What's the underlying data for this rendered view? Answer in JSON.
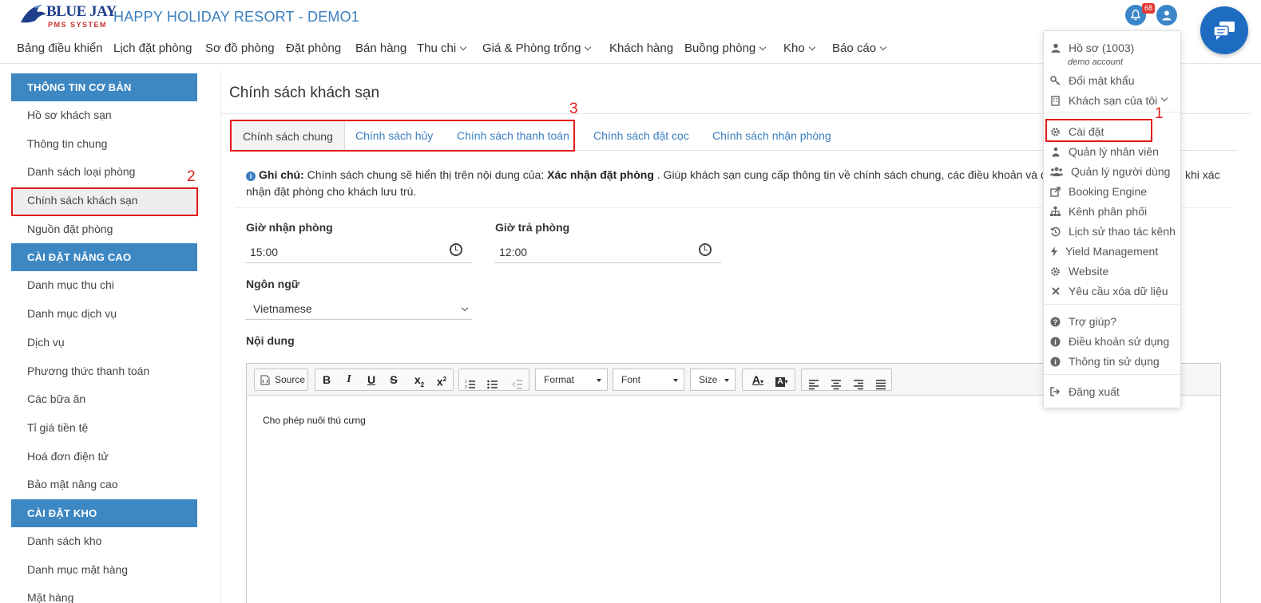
{
  "brand": {
    "logo_main": "BLUE JAY",
    "logo_sub": "PMS SYSTEM",
    "app_title": "HAPPY HOLIDAY RESORT - DEMO1",
    "notification_count": "68"
  },
  "nav": [
    {
      "label": "Bảng điều khiển"
    },
    {
      "label": "Lịch đặt phòng"
    },
    {
      "label": "Sơ đồ phòng"
    },
    {
      "label": "Đặt phòng"
    },
    {
      "label": "Bán hàng"
    },
    {
      "label": "Thu chi"
    },
    {
      "label": "Giá & Phòng trống"
    },
    {
      "label": "Khách hàng"
    },
    {
      "label": "Buồng phòng"
    },
    {
      "label": "Kho"
    },
    {
      "label": "Báo cáo"
    }
  ],
  "sidebar": {
    "section_basic": "THÔNG TIN CƠ BẢN",
    "basic_items": [
      "Hồ sơ khách sạn",
      "Thông tin chung",
      "Danh sách loại phòng",
      "Chính sách khách sạn",
      "Nguồn đặt phòng"
    ],
    "section_advanced": "CÀI ĐẶT NÂNG CAO",
    "advanced_items": [
      "Danh mục thu chi",
      "Danh mục dịch vụ",
      "Dịch vụ",
      "Phương thức thanh toán",
      "Các bữa ăn",
      "Tỉ giá tiền tệ",
      "Hoá đơn điện tử",
      "Bảo mật nâng cao"
    ],
    "section_stock": "CÀI ĐẶT KHO",
    "stock_items": [
      "Danh sách kho",
      "Danh mục mặt hàng",
      "Mặt hàng"
    ]
  },
  "page": {
    "title": "Chính sách khách sạn",
    "tabs": [
      "Chính sách chung",
      "Chính sách hủy",
      "Chính sách thanh toán",
      "Chính sách đặt cọc",
      "Chính sách nhận phòng"
    ],
    "note_label": "Ghi chú:",
    "note_text_1": " Chính sách chung sẽ hiển thị trên nội dung của: ",
    "note_bold": "Xác nhận đặt phòng",
    "note_text_2": " . Giúp khách sạn cung cấp thông tin về chính sách chung, các điều khoản và điều",
    "note_text_3": "khi xác",
    "note_text_4": "nhận đặt phòng cho khách lưu trú.",
    "checkin_label": "Giờ nhận phòng",
    "checkin_value": "15:00",
    "checkout_label": "Giờ trả phòng",
    "checkout_value": "12:00",
    "language_label": "Ngôn ngữ",
    "language_value": "Vietnamese",
    "content_label": "Nội dung",
    "editor": {
      "source_label": "Source",
      "format_label": "Format",
      "font_label": "Font",
      "size_label": "Size",
      "body_text": "Cho phép nuôi thú cưng"
    }
  },
  "dropdown": {
    "profile": "Hồ sơ  (1003)",
    "profile_sub": "demo account",
    "change_password": "Đổi mật khẩu",
    "my_hotels": "Khách sạn của tôi",
    "settings": "Cài đặt",
    "staff": "Quản lý nhân viên",
    "users": "Quản lý người dùng",
    "booking_engine": "Booking Engine",
    "channels": "Kênh phân phối",
    "channel_log": "Lịch sử thao tác kênh",
    "yield": "Yield Management",
    "website": "Website",
    "delete_data": "Yêu cầu xóa dữ liệu",
    "help": "Trợ giúp?",
    "terms": "Điều khoản sử dụng",
    "usage_info": "Thông tin sử dụng",
    "logout": "Đăng xuất"
  },
  "annotations": {
    "n1": "1",
    "n2": "2",
    "n3": "3"
  },
  "colors": {
    "accent": "#3d87c2",
    "annotation_red": "#e21c1c",
    "link": "#3a7fc0"
  }
}
